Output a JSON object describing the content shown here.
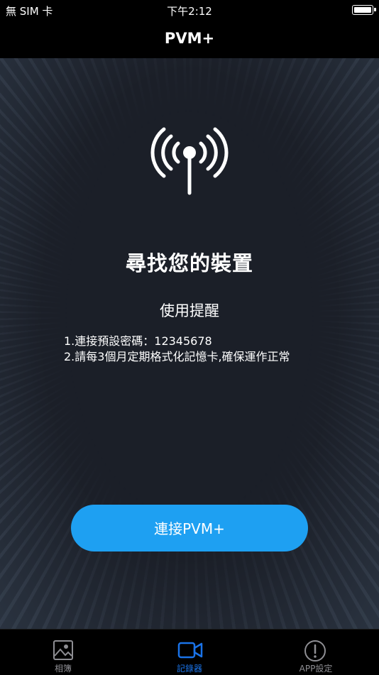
{
  "status_bar": {
    "carrier": "無 SIM 卡",
    "time": "下午2:12",
    "battery_icon": "battery-icon"
  },
  "nav": {
    "title": "PVM+"
  },
  "main": {
    "icon": "wifi-antenna-icon",
    "title": "尋找您的裝置",
    "tips_title": "使用提醒",
    "tips": [
      "1.連接預設密碼：12345678",
      "2.請每3個月定期格式化記憶卡,確保運作正常"
    ],
    "connect_button": "連接PVM+"
  },
  "tabs": [
    {
      "label": "相簿",
      "icon": "photo-album-icon",
      "active": false
    },
    {
      "label": "記錄器",
      "icon": "video-camera-icon",
      "active": true
    },
    {
      "label": "APP設定",
      "icon": "alert-circle-icon",
      "active": false
    }
  ],
  "colors": {
    "accent": "#1ea0f2",
    "active_tab": "#1a73e8",
    "inactive_tab": "#8e8e93",
    "background": "#1b1f28"
  }
}
